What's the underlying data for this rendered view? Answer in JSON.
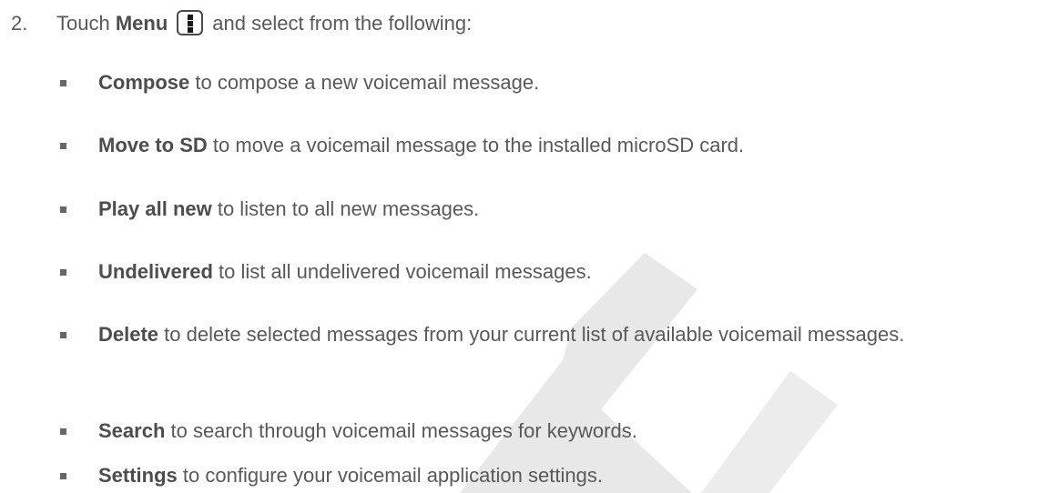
{
  "step": {
    "number": "2.",
    "prefix": "Touch",
    "menu_label": "Menu",
    "suffix": "and select from the following:",
    "menu_icon": "vertical-dots-menu-icon"
  },
  "options": [
    {
      "term": "Compose",
      "desc": " to compose a new voicemail message."
    },
    {
      "term": "Move to SD",
      "desc": " to move a voicemail message to the installed microSD card."
    },
    {
      "term": "Play all new",
      "desc": " to listen to all new messages."
    },
    {
      "term": "Undelivered",
      "desc": " to list all undelivered voicemail messages."
    },
    {
      "term": "Delete",
      "desc": " to delete selected messages from your current list of available voicemail messages."
    },
    {
      "term": "Search",
      "desc": " to search through voicemail messages for keywords."
    },
    {
      "term": "Settings",
      "desc": " to configure your voicemail application settings."
    }
  ],
  "colors": {
    "text": "#595959",
    "watermark": "#e6e6e6"
  }
}
